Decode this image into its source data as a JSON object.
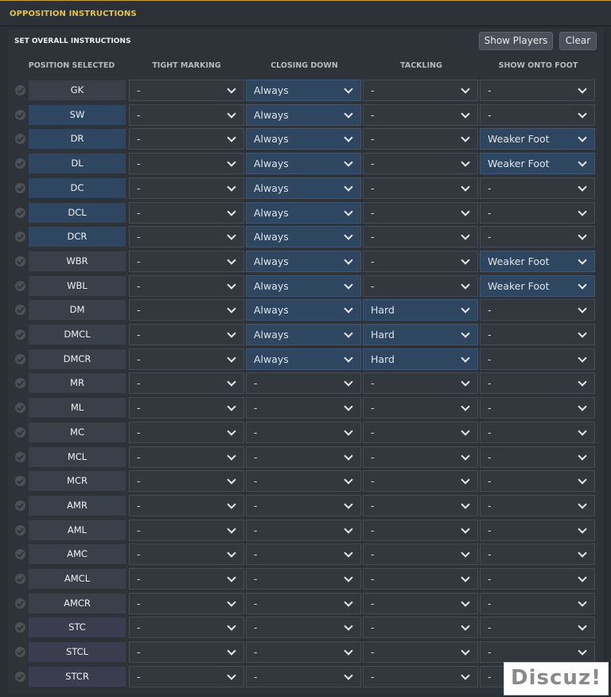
{
  "window": {
    "title": "OPPOSITION INSTRUCTIONS"
  },
  "panel": {
    "section_title": "SET OVERALL INSTRUCTIONS",
    "show_players_label": "Show Players",
    "clear_label": "Clear"
  },
  "columns": [
    "POSITION SELECTED",
    "TIGHT MARKING",
    "CLOSING DOWN",
    "TACKLING",
    "SHOW ONTO FOOT"
  ],
  "rows": [
    {
      "position": "GK",
      "tight_marking": "-",
      "closing_down": "Always",
      "tackling": "-",
      "show_onto_foot": "-"
    },
    {
      "position": "SW",
      "tight_marking": "-",
      "closing_down": "Always",
      "tackling": "-",
      "show_onto_foot": "-"
    },
    {
      "position": "DR",
      "tight_marking": "-",
      "closing_down": "Always",
      "tackling": "-",
      "show_onto_foot": "Weaker Foot"
    },
    {
      "position": "DL",
      "tight_marking": "-",
      "closing_down": "Always",
      "tackling": "-",
      "show_onto_foot": "Weaker Foot"
    },
    {
      "position": "DC",
      "tight_marking": "-",
      "closing_down": "Always",
      "tackling": "-",
      "show_onto_foot": "-"
    },
    {
      "position": "DCL",
      "tight_marking": "-",
      "closing_down": "Always",
      "tackling": "-",
      "show_onto_foot": "-"
    },
    {
      "position": "DCR",
      "tight_marking": "-",
      "closing_down": "Always",
      "tackling": "-",
      "show_onto_foot": "-"
    },
    {
      "position": "WBR",
      "tight_marking": "-",
      "closing_down": "Always",
      "tackling": "-",
      "show_onto_foot": "Weaker Foot"
    },
    {
      "position": "WBL",
      "tight_marking": "-",
      "closing_down": "Always",
      "tackling": "-",
      "show_onto_foot": "Weaker Foot"
    },
    {
      "position": "DM",
      "tight_marking": "-",
      "closing_down": "Always",
      "tackling": "Hard",
      "show_onto_foot": "-"
    },
    {
      "position": "DMCL",
      "tight_marking": "-",
      "closing_down": "Always",
      "tackling": "Hard",
      "show_onto_foot": "-"
    },
    {
      "position": "DMCR",
      "tight_marking": "-",
      "closing_down": "Always",
      "tackling": "Hard",
      "show_onto_foot": "-"
    },
    {
      "position": "MR",
      "tight_marking": "-",
      "closing_down": "-",
      "tackling": "-",
      "show_onto_foot": "-"
    },
    {
      "position": "ML",
      "tight_marking": "-",
      "closing_down": "-",
      "tackling": "-",
      "show_onto_foot": "-"
    },
    {
      "position": "MC",
      "tight_marking": "-",
      "closing_down": "-",
      "tackling": "-",
      "show_onto_foot": "-"
    },
    {
      "position": "MCL",
      "tight_marking": "-",
      "closing_down": "-",
      "tackling": "-",
      "show_onto_foot": "-"
    },
    {
      "position": "MCR",
      "tight_marking": "-",
      "closing_down": "-",
      "tackling": "-",
      "show_onto_foot": "-"
    },
    {
      "position": "AMR",
      "tight_marking": "-",
      "closing_down": "-",
      "tackling": "-",
      "show_onto_foot": "-"
    },
    {
      "position": "AML",
      "tight_marking": "-",
      "closing_down": "-",
      "tackling": "-",
      "show_onto_foot": "-"
    },
    {
      "position": "AMC",
      "tight_marking": "-",
      "closing_down": "-",
      "tackling": "-",
      "show_onto_foot": "-"
    },
    {
      "position": "AMCL",
      "tight_marking": "-",
      "closing_down": "-",
      "tackling": "-",
      "show_onto_foot": "-"
    },
    {
      "position": "AMCR",
      "tight_marking": "-",
      "closing_down": "-",
      "tackling": "-",
      "show_onto_foot": "-"
    },
    {
      "position": "STC",
      "tight_marking": "-",
      "closing_down": "-",
      "tackling": "-",
      "show_onto_foot": "-"
    },
    {
      "position": "STCL",
      "tight_marking": "-",
      "closing_down": "-",
      "tackling": "-",
      "show_onto_foot": "-"
    },
    {
      "position": "STCR",
      "tight_marking": "-",
      "closing_down": "-",
      "tackling": "-",
      "show_onto_foot": "-"
    }
  ],
  "watermark": "Discuz!",
  "colors": {
    "title_accent": "#e4c24a",
    "selected_dropdown": "#2f4660",
    "dropdown": "#33383f",
    "panel_bg": "#2e333a"
  }
}
